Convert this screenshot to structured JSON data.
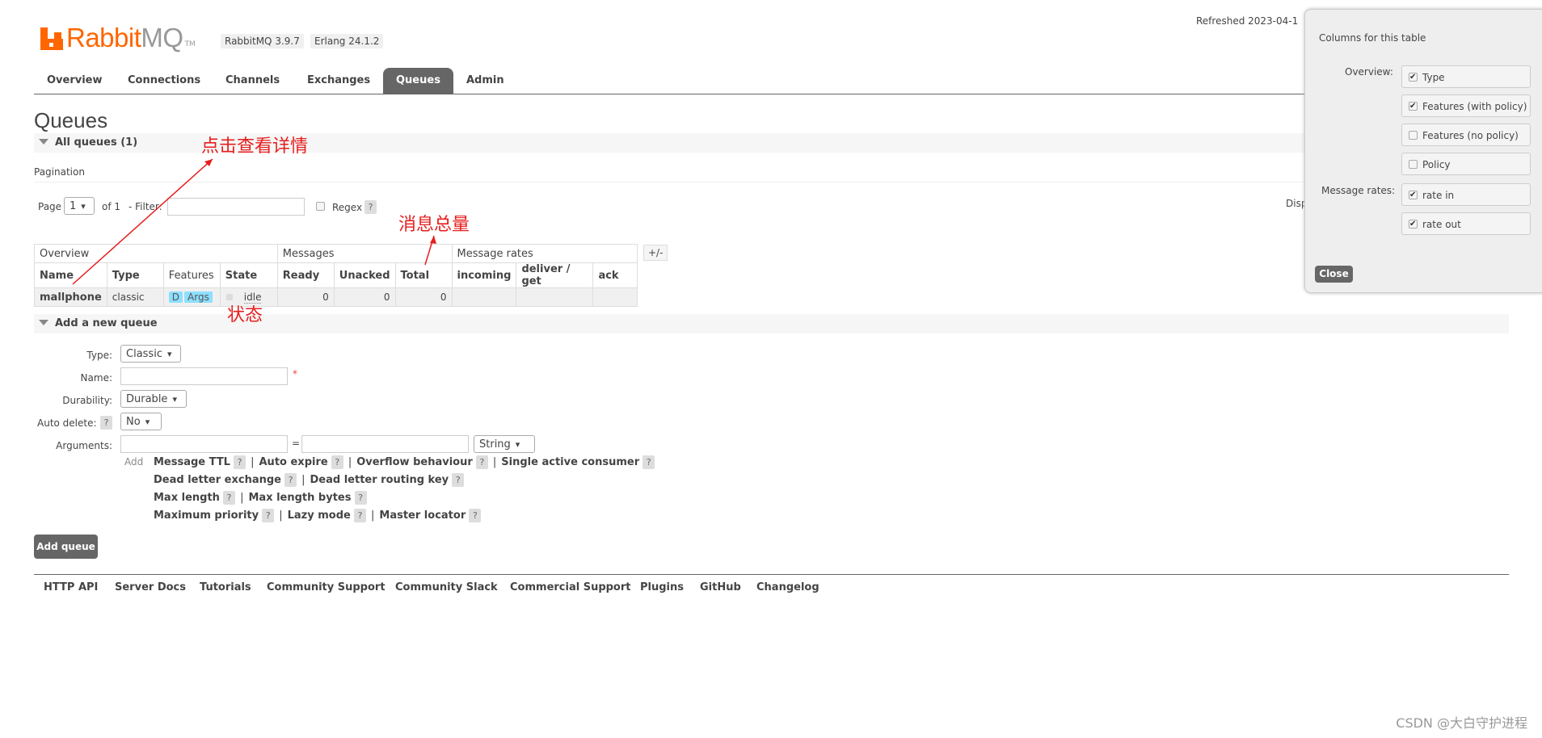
{
  "app": {
    "logo_brand": "Rabbit",
    "logo_mq": "MQ",
    "logo_tm": "TM",
    "rabbitmq_version": "RabbitMQ 3.9.7",
    "erlang_version": "Erlang 24.1.2",
    "refreshed": "Refreshed 2023-04-1"
  },
  "tabs": [
    "Overview",
    "Connections",
    "Channels",
    "Exchanges",
    "Queues",
    "Admin"
  ],
  "active_tab": "Queues",
  "page_title": "Queues",
  "all_queues": {
    "label": "All queues (1)"
  },
  "pagination": {
    "label": "Pagination",
    "page_label": "Page",
    "page_value": "1",
    "of_label": "of 1",
    "filter_label": "- Filter:",
    "regex_label": "Regex",
    "help": "?",
    "display_label": "Disp"
  },
  "table": {
    "group_headers": [
      "Overview",
      "Messages",
      "Message rates"
    ],
    "columns": [
      "Name",
      "Type",
      "Features",
      "State",
      "Ready",
      "Unacked",
      "Total",
      "incoming",
      "deliver / get",
      "ack"
    ],
    "plus_minus": "+/-",
    "rows": [
      {
        "name": "mallphone",
        "type": "classic",
        "feature_d": "D",
        "feature_args": "Args",
        "state": "idle",
        "ready": "0",
        "unacked": "0",
        "total": "0"
      }
    ]
  },
  "add_queue": {
    "section_label": "Add a new queue",
    "type_label": "Type:",
    "type_value": "Classic",
    "name_label": "Name:",
    "required": "*",
    "durability_label": "Durability:",
    "durability_value": "Durable",
    "auto_delete_label": "Auto delete:",
    "auto_delete_value": "No",
    "arguments_label": "Arguments:",
    "equals": "=",
    "arg_type_value": "String",
    "add_label": "Add",
    "arg_links": [
      [
        "Message TTL",
        "Auto expire",
        "Overflow behaviour",
        "Single active consumer"
      ],
      [
        "Dead letter exchange",
        "Dead letter routing key"
      ],
      [
        "Max length",
        "Max length bytes"
      ],
      [
        "Maximum priority",
        "Lazy mode",
        "Master locator"
      ]
    ],
    "separator": "|",
    "button": "Add queue"
  },
  "footer": [
    "HTTP API",
    "Server Docs",
    "Tutorials",
    "Community Support",
    "Community Slack",
    "Commercial Support",
    "Plugins",
    "GitHub",
    "Changelog"
  ],
  "columns_panel": {
    "title": "Columns for this table",
    "overview_label": "Overview:",
    "overview_options": [
      {
        "label": "Type",
        "checked": true
      },
      {
        "label": "Features (with policy)",
        "checked": true
      },
      {
        "label": "Features (no policy)",
        "checked": false
      },
      {
        "label": "Policy",
        "checked": false
      }
    ],
    "rates_label": "Message rates:",
    "rates_options": [
      {
        "label": "rate in",
        "checked": true
      },
      {
        "label": "rate out",
        "checked": true
      }
    ],
    "close": "Close"
  },
  "annotations": {
    "details": "点击查看详情",
    "total": "消息总量",
    "state": "状态"
  },
  "watermark": "CSDN @大白守护进程",
  "colors": {
    "brand": "#ff6600",
    "annotation": "#e61e1e",
    "badge": "#8ddfff",
    "tab_active": "#666666"
  }
}
